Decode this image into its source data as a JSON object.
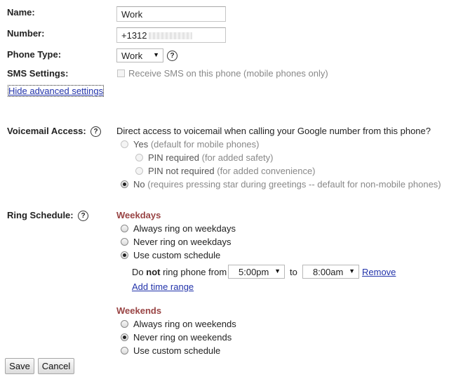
{
  "form": {
    "name_label": "Name:",
    "name_value": "Work",
    "number_label": "Number:",
    "number_value": "+1312",
    "phone_type_label": "Phone Type:",
    "phone_type_value": "Work",
    "sms_label": "SMS Settings:",
    "sms_checkbox_text": "Receive SMS on this phone (mobile phones only)",
    "hide_advanced_link": "Hide advanced settings"
  },
  "voicemail": {
    "label": "Voicemail Access:",
    "description": "Direct access to voicemail when calling your Google number from this phone?",
    "yes_label": "Yes",
    "yes_note": "(default for mobile phones)",
    "pin_required_label": "PIN required",
    "pin_required_note": "(for added safety)",
    "pin_not_required_label": "PIN not required",
    "pin_not_required_note": "(for added convenience)",
    "no_label": "No",
    "no_note": "(requires pressing star during greetings -- default for non-mobile phones)",
    "selected": "No"
  },
  "ring_schedule": {
    "label": "Ring Schedule:",
    "weekdays_heading": "Weekdays",
    "weekdays_always": "Always ring on weekdays",
    "weekdays_never": "Never ring on weekdays",
    "weekdays_custom": "Use custom schedule",
    "weekdays_selected": "Use custom schedule",
    "do_text": "Do",
    "not_text": "not",
    "ring_from_text": "ring phone from",
    "from_time": "5:00pm",
    "to_text": "to",
    "to_time": "8:00am",
    "remove_link": "Remove",
    "add_time_range_link": "Add time range",
    "weekends_heading": "Weekends",
    "weekends_always": "Always ring on weekends",
    "weekends_never": "Never ring on weekends",
    "weekends_custom": "Use custom schedule",
    "weekends_selected": "Never ring on weekends"
  },
  "buttons": {
    "save": "Save",
    "cancel": "Cancel"
  },
  "icons": {
    "help": "?",
    "dropdown": "▼"
  },
  "colors": {
    "heading": "#994444",
    "link": "#2233aa"
  }
}
